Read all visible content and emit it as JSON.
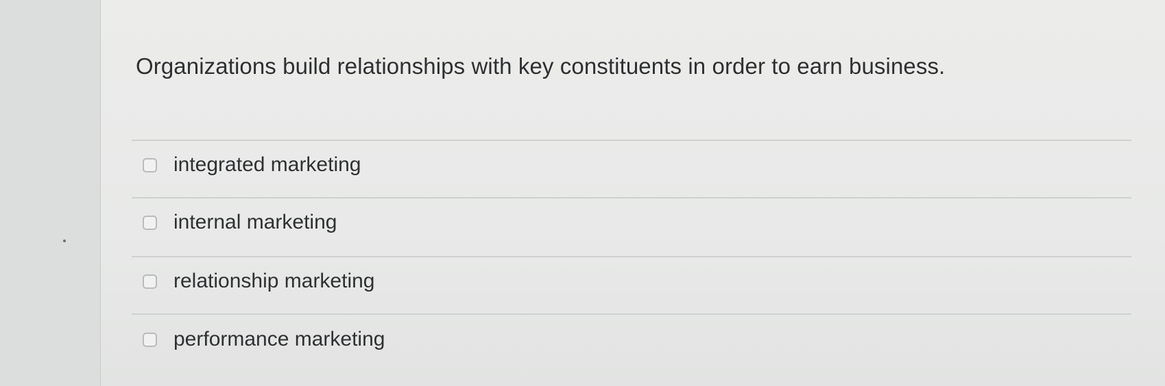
{
  "question": {
    "text": "Organizations build relationships with key constituents in order to earn business."
  },
  "options": [
    {
      "label": "integrated marketing",
      "checked": false
    },
    {
      "label": "internal marketing",
      "checked": false
    },
    {
      "label": "relationship marketing",
      "checked": false
    },
    {
      "label": "performance marketing",
      "checked": false
    }
  ]
}
